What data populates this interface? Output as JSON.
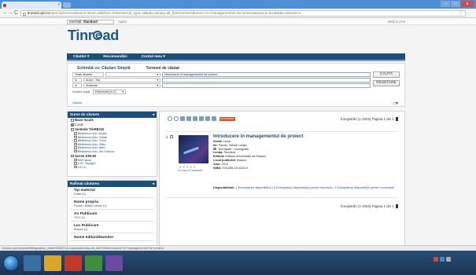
{
  "browser": {
    "tab_title": "",
    "tab_close": "×",
    "url_host": "tinread.upit.ro",
    "url_rest": "/opac/advancedsearch?level=all&limit=20&material_type=all&ab=asc&q=all_title%3Aintroducere+in+managementul+de+proiect&source=local&ab=relevance",
    "back": "←",
    "forward": "→",
    "reload": "C",
    "bookmark_star": "☆",
    "win_min": "–",
    "win_max": "□",
    "win_close": "x"
  },
  "top_strip": {
    "interface_label": "Interfață:",
    "interface_value": "Standard",
    "help": "Ajutor",
    "login": "Intră în cont"
  },
  "logo": {
    "text_pre": "Tinr",
    "text_at": "e",
    "text_post": "ad"
  },
  "nav": {
    "items": [
      "Căutări ▾",
      "Recomandări",
      "Contul meu ▾"
    ]
  },
  "search": {
    "tab_active": "Schimbă cu: Căutare Simplă",
    "tab_inactive": "Termeni de căutat",
    "row1_scope": "Toate filiarele",
    "row1_field": "",
    "row1_value": "introducere in managementul de proiect",
    "row2_op": "și",
    "row2_field": "Autor - Toti",
    "row3_op": "și",
    "row3_field": "Subiecte",
    "sort_label": "Sortare după",
    "sort_value": "Relevanță (A-Z)",
    "search_button": "CAUTĂ",
    "reset_button": "RESETARE",
    "options": "Opțiuni",
    "cart_icon": "⌂▾"
  },
  "sidebar_sources": {
    "header": "Surse de căutare",
    "collapse": "◂",
    "items": [
      {
        "label": "Baze locale",
        "type": "h",
        "checked": false
      },
      {
        "label": "Local",
        "type": "plain",
        "checked": true
      },
      {
        "label": "Sisteme TinREAD",
        "type": "h",
        "checked": false
      },
      {
        "label": "Biblioteca Univ. Arges",
        "type": "sub"
      },
      {
        "label": "Biblioteca Univ. Galați",
        "type": "sub"
      },
      {
        "label": "Biblioteca Univ. Timiș",
        "type": "sub"
      },
      {
        "label": "Biblioteca Univ. Sibiu",
        "type": "sub"
      },
      {
        "label": "Biblioteca Univ. Alba",
        "type": "sub"
      },
      {
        "label": "Biblioteca Univ. din Craiova",
        "type": "sub"
      },
      {
        "label": "Surse Z39.50",
        "type": "h",
        "checked": false
      },
      {
        "label": "BNFrance",
        "type": "sub"
      },
      {
        "label": "LOC Voyager",
        "type": "sub"
      },
      {
        "label": "OCLC",
        "type": "sub"
      }
    ]
  },
  "sidebar_refine": {
    "header": "Rafinați căutarea",
    "collapse": "◂",
    "groups": [
      {
        "title": "Tip material",
        "value": "Carte (1)"
      },
      {
        "title": "Nume propriu",
        "value": "Panciu, Mihail Lucian (1)"
      },
      {
        "title": "An Publicare",
        "value": "2012 (1)"
      },
      {
        "title": "Loc Publicare",
        "value": "Brașov (1)"
      },
      {
        "title": "Nume editură/Numitor",
        "value": ""
      }
    ]
  },
  "results": {
    "bookmark_label": "BOOKMARK",
    "pager_top": "Înregistrări (1-1004) Pagina 1 din 1",
    "pager_bottom": "Înregistrări (1-1004) Pagina 1 din 1",
    "record": {
      "number": "1.",
      "title": "Introducere în managementul de proiect",
      "meta": [
        {
          "k": "Sursă:",
          "v": "Local"
        },
        {
          "k": "de:",
          "v": "Panciu, Mihail Lucian"
        },
        {
          "k": "",
          "v": "Text tipărit : monografic",
          "book": true
        },
        {
          "k": "Limba:",
          "v": "Română"
        },
        {
          "k": "Editură:",
          "v": "Editura Universității din Brașov"
        },
        {
          "k": "Locul publicării:",
          "v": "Brașov"
        },
        {
          "k": "Anul:",
          "v": "2012"
        },
        {
          "k": "ISBN:",
          "v": "978-606-19-0222-0"
        }
      ],
      "stars": "★★★★★",
      "add_basket": "Î n coș o © recenzii",
      "avail_label": "Disponibilitate:",
      "avail_text": "1 Exemplar(e) disponibil(e) | 0 Exemplar(e) disponibil(e) pentru împrumut | 1 Exemplar(e) disponibil(e) pentru consultare"
    }
  },
  "statusbar": {
    "text": "tinread.upit.ro/opac/bibliographic_view/192049?pn=opacsearch&q=all_title%3Aintroducere+in+managementul+de+proiect"
  },
  "taskbar": {
    "clock_time": "",
    "clock_date": ""
  },
  "colors": {
    "nav": "#1f4e79",
    "accent_link": "#1f4e79",
    "tabbar": "#4d8fd6",
    "bookmark": "#d64f2a"
  }
}
